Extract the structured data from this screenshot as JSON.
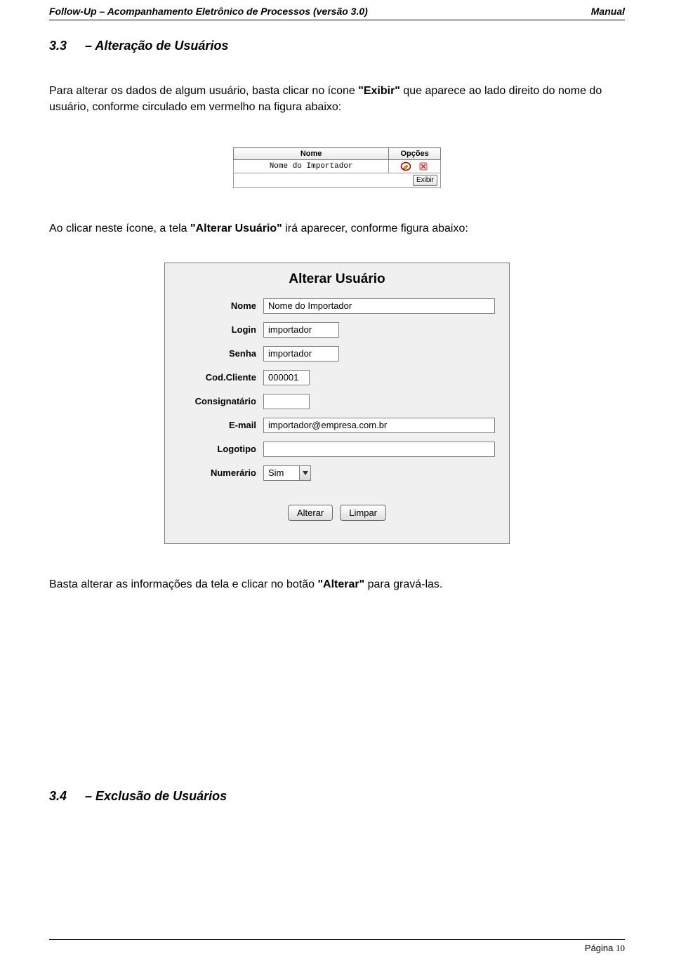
{
  "header": {
    "left": "Follow-Up – Acompanhamento Eletrônico de Processos (versão 3.0)",
    "right": "Manual"
  },
  "section1": {
    "num": "3.3",
    "title": "– Alteração de Usuários"
  },
  "para1_pre": "Para alterar os dados de algum usuário, basta clicar no ícone ",
  "para1_bold": "\"Exibir\"",
  "para1_post": " que aparece ao lado direito do nome do usuário, conforme circulado em vermelho na figura abaixo:",
  "listTable": {
    "cols": {
      "nome": "Nome",
      "opcoes": "Opções"
    },
    "row": {
      "nome": "Nome do Importador"
    },
    "exibirBtn": "Exibir"
  },
  "para2_pre": "Ao clicar neste ícone, a tela ",
  "para2_bold": "\"Alterar Usuário\"",
  "para2_post": " irá aparecer, conforme figura abaixo:",
  "panel": {
    "title": "Alterar Usuário",
    "labels": {
      "nome": "Nome",
      "login": "Login",
      "senha": "Senha",
      "cod": "Cod.Cliente",
      "consig": "Consignatário",
      "email": "E-mail",
      "logo": "Logotipo",
      "numer": "Numerário"
    },
    "values": {
      "nome": "Nome do Importador",
      "login": "importador",
      "senha": "importador",
      "cod": "000001",
      "consig": "",
      "email": "importador@empresa.com.br",
      "logo": "",
      "numer": "Sim"
    },
    "buttons": {
      "alterar": "Alterar",
      "limpar": "Limpar"
    }
  },
  "para3_pre": "Basta alterar as informações da tela e clicar no botão ",
  "para3_bold": "\"Alterar\"",
  "para3_post": " para gravá-las.",
  "section2": {
    "num": "3.4",
    "title": "– Exclusão de Usuários"
  },
  "footer": {
    "label": "Página ",
    "num": "10"
  }
}
